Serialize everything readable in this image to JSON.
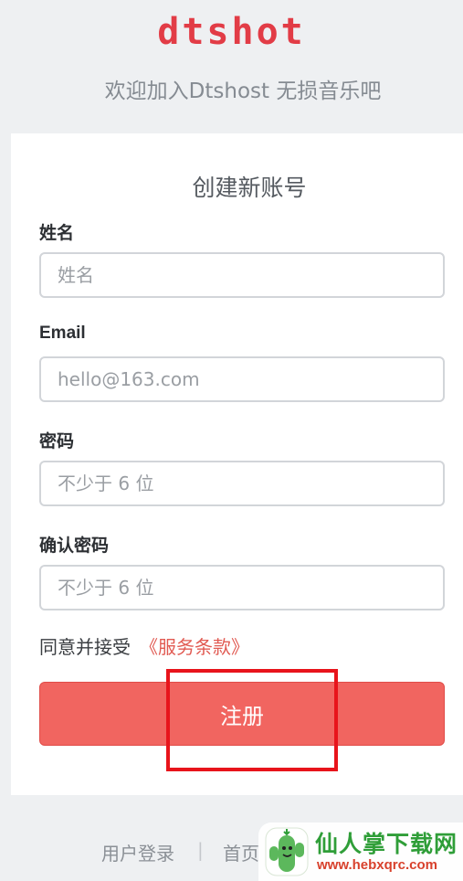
{
  "header": {
    "logo_text": "dtshot",
    "tagline": "欢迎加入Dtshost 无损音乐吧"
  },
  "form": {
    "title": "创建新账号",
    "fields": [
      {
        "label": "姓名",
        "placeholder": "姓名",
        "value": ""
      },
      {
        "label": "Email",
        "placeholder": "hello@163.com",
        "value": ""
      },
      {
        "label": "密码",
        "placeholder": "不少于 6 位",
        "value": ""
      },
      {
        "label": "确认密码",
        "placeholder": "不少于 6 位",
        "value": ""
      }
    ],
    "agree_text": "同意并接受",
    "terms_link": "《服务条款》",
    "submit_label": "注册"
  },
  "footer": {
    "login_link": "用户登录",
    "separator": "|",
    "home_link": "首页"
  },
  "watermark": {
    "site_name": "仙人掌下载网",
    "url": "www.hebxqrc.com"
  },
  "colors": {
    "brand": "#e23c46",
    "submit": "#f16560",
    "terms_link": "#e15a52",
    "highlight_box": "#e8141b",
    "page_bg": "#eef0f2"
  }
}
